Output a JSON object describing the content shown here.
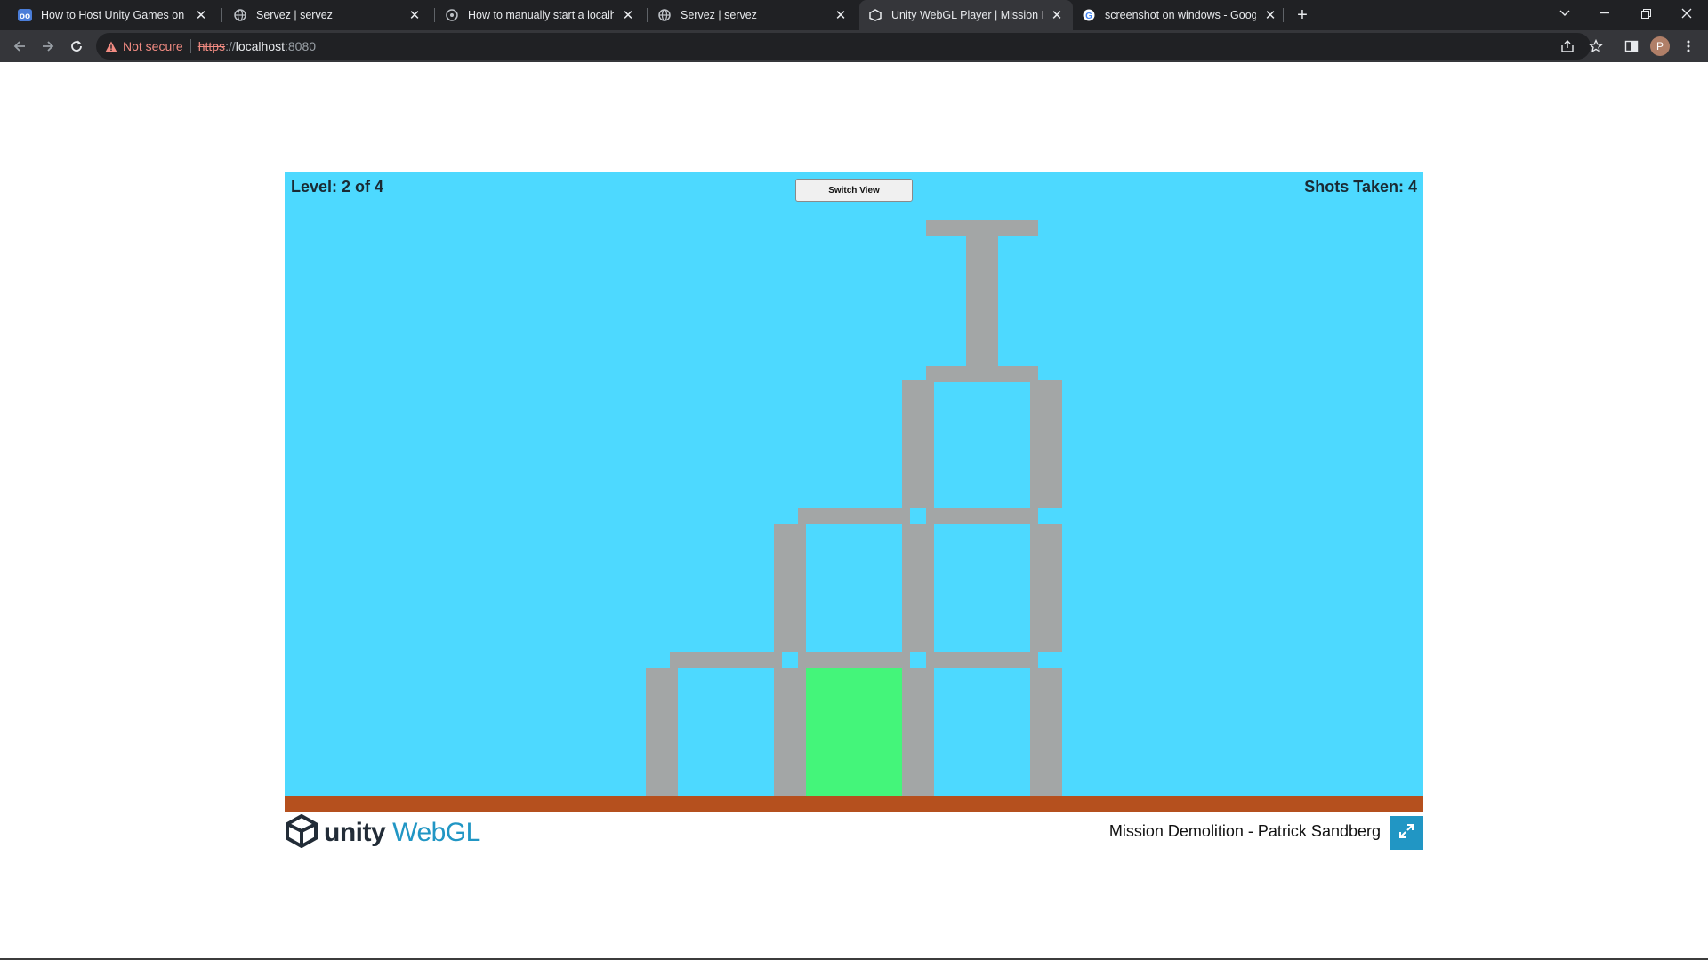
{
  "browser": {
    "tabs": [
      {
        "title": "How to Host Unity Games on the",
        "icon": "infinity-icon"
      },
      {
        "title": "Servez | servez",
        "icon": "globe-icon"
      },
      {
        "title": "How to manually start a localhost",
        "icon": "network-icon"
      },
      {
        "title": "Servez | servez",
        "icon": "globe-icon"
      },
      {
        "title": "Unity WebGL Player | Mission De",
        "icon": "unity-icon",
        "active": true
      },
      {
        "title": "screenshot on windows - Google",
        "icon": "google-icon"
      }
    ],
    "address": {
      "security_label": "Not secure",
      "scheme": "https",
      "scheme_sep": "://",
      "host": "localhost",
      "port": ":8080"
    },
    "profile_initial": "P"
  },
  "game": {
    "level_text": "Level: 2 of 4",
    "shots_text": "Shots Taken: 4",
    "switch_view_label": "Switch View",
    "colors": {
      "sky": "#4dd9ff",
      "block": "#a3a6a6",
      "goal": "#44f57a",
      "ground": "#b5501e"
    }
  },
  "footer": {
    "logo_word": "unity",
    "logo_suffix": "WebGL",
    "title": "Mission Demolition - Patrick Sandberg"
  }
}
